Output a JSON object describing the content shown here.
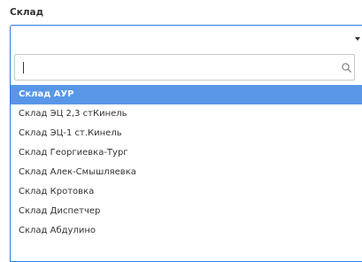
{
  "field": {
    "label": "Склад",
    "value": ""
  },
  "search": {
    "value": "",
    "placeholder": ""
  },
  "options": [
    {
      "label": "Склад АУР",
      "selected": true
    },
    {
      "label": "Склад ЭЦ 2,3 стКинель",
      "selected": false
    },
    {
      "label": "Склад ЭЦ-1 ст.Кинель",
      "selected": false
    },
    {
      "label": "Склад Георгиевка-Тург",
      "selected": false
    },
    {
      "label": "Склад Алек-Смышляевка",
      "selected": false
    },
    {
      "label": "Склад Кротовка",
      "selected": false
    },
    {
      "label": "Склад Диспетчер",
      "selected": false
    },
    {
      "label": "Склад Абдулино",
      "selected": false
    }
  ],
  "colors": {
    "accent_border": "#2e7bd6",
    "selected_background": "#5897e8",
    "text": "#333333"
  },
  "icons": {
    "dropdown_arrow": "chevron-down-icon",
    "search": "search-icon"
  }
}
